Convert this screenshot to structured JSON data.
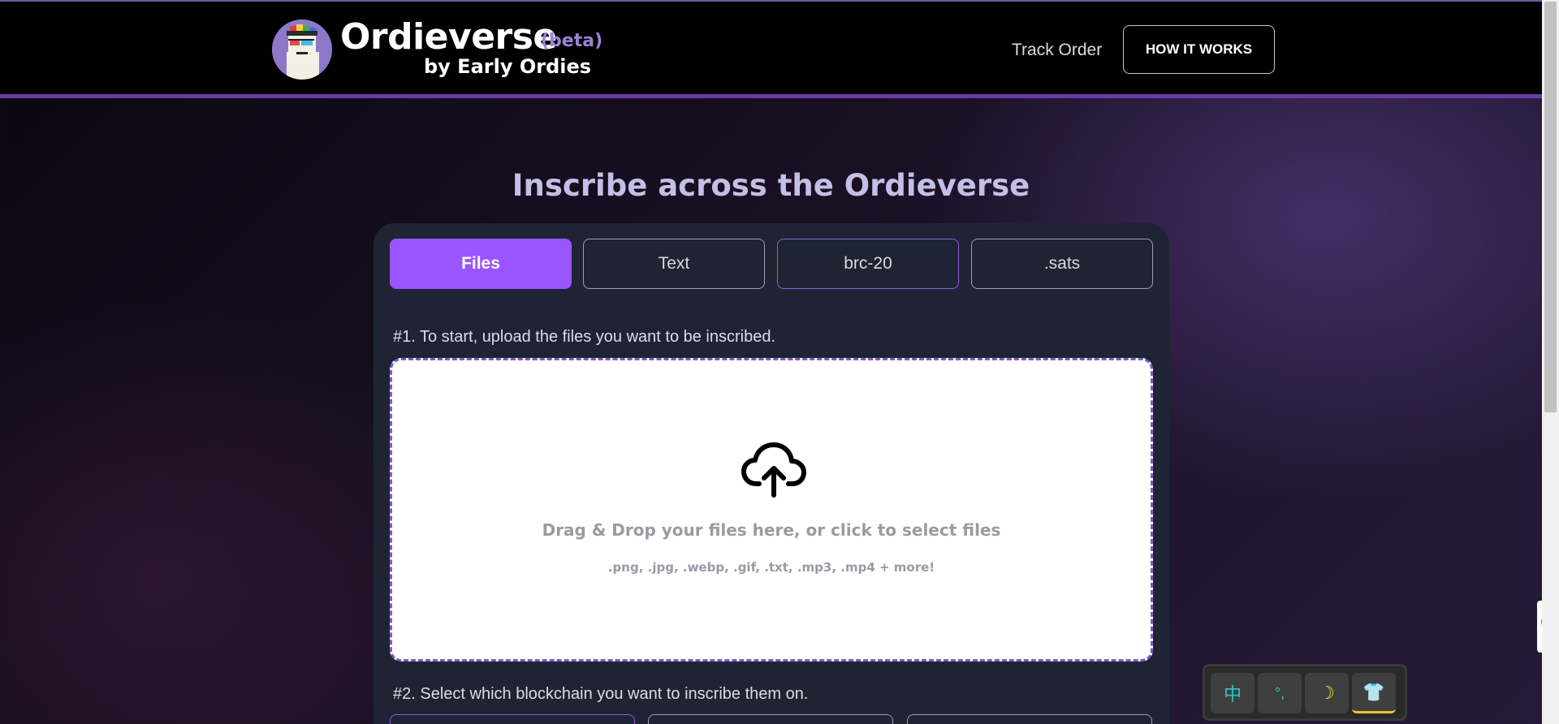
{
  "header": {
    "brand_name": "Ordieverse",
    "brand_badge": "(beta)",
    "brand_sub": "by Early Ordies",
    "nav": {
      "track_order": "Track Order",
      "how_it_works": "HOW IT WORKS"
    }
  },
  "main": {
    "title": "Inscribe across the Ordieverse",
    "tabs": [
      {
        "label": "Files",
        "active": true
      },
      {
        "label": "Text",
        "active": false
      },
      {
        "label": "brc-20",
        "active": false
      },
      {
        "label": ".sats",
        "active": false
      }
    ],
    "step1": "#1. To start, upload the files you want to be inscribed.",
    "dropzone": {
      "main_text": "Drag & Drop your files here, or click to select files",
      "formats": ".png, .jpg, .webp, .gif, .txt, .mp3, .mp4 + more!"
    },
    "step2": "#2. Select which blockchain you want to inscribe them on."
  },
  "ime_toolbar": {
    "keys": [
      {
        "label": "中",
        "icon": "chinese-mode-icon"
      },
      {
        "label": "°,",
        "icon": "punctuation-icon"
      },
      {
        "label": "☽",
        "icon": "moon-icon"
      },
      {
        "label": "👕",
        "icon": "skin-icon"
      }
    ]
  },
  "colors": {
    "accent": "#9a55ff",
    "header_border": "#6a3aa8",
    "card_bg": "#1f2434",
    "title": "#c3bfe6"
  }
}
